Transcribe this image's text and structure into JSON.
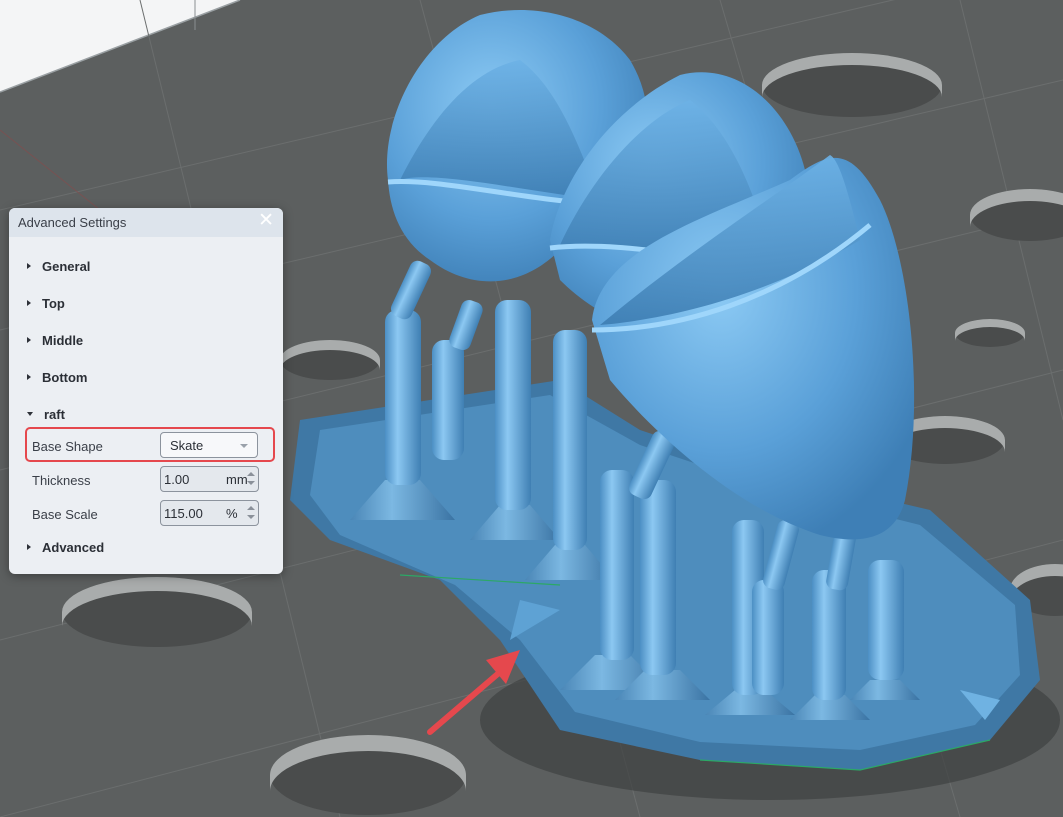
{
  "panel": {
    "title": "Advanced Settings",
    "close_glyph": "✕",
    "sections": {
      "general": "General",
      "top": "Top",
      "middle": "Middle",
      "bottom": "Bottom",
      "raft": "raft",
      "advanced": "Advanced"
    },
    "raft": {
      "base_shape": {
        "label": "Base Shape",
        "value": "Skate"
      },
      "thickness": {
        "label": "Thickness",
        "value": "1.00",
        "unit": "mm"
      },
      "base_scale": {
        "label": "Base Scale",
        "value": "115.00",
        "unit": "%"
      }
    }
  },
  "colors": {
    "model": "#5aa0d8",
    "raft": "#4a88b5",
    "build_plate": "#5c5f5f",
    "annotation": "#e5484d"
  }
}
